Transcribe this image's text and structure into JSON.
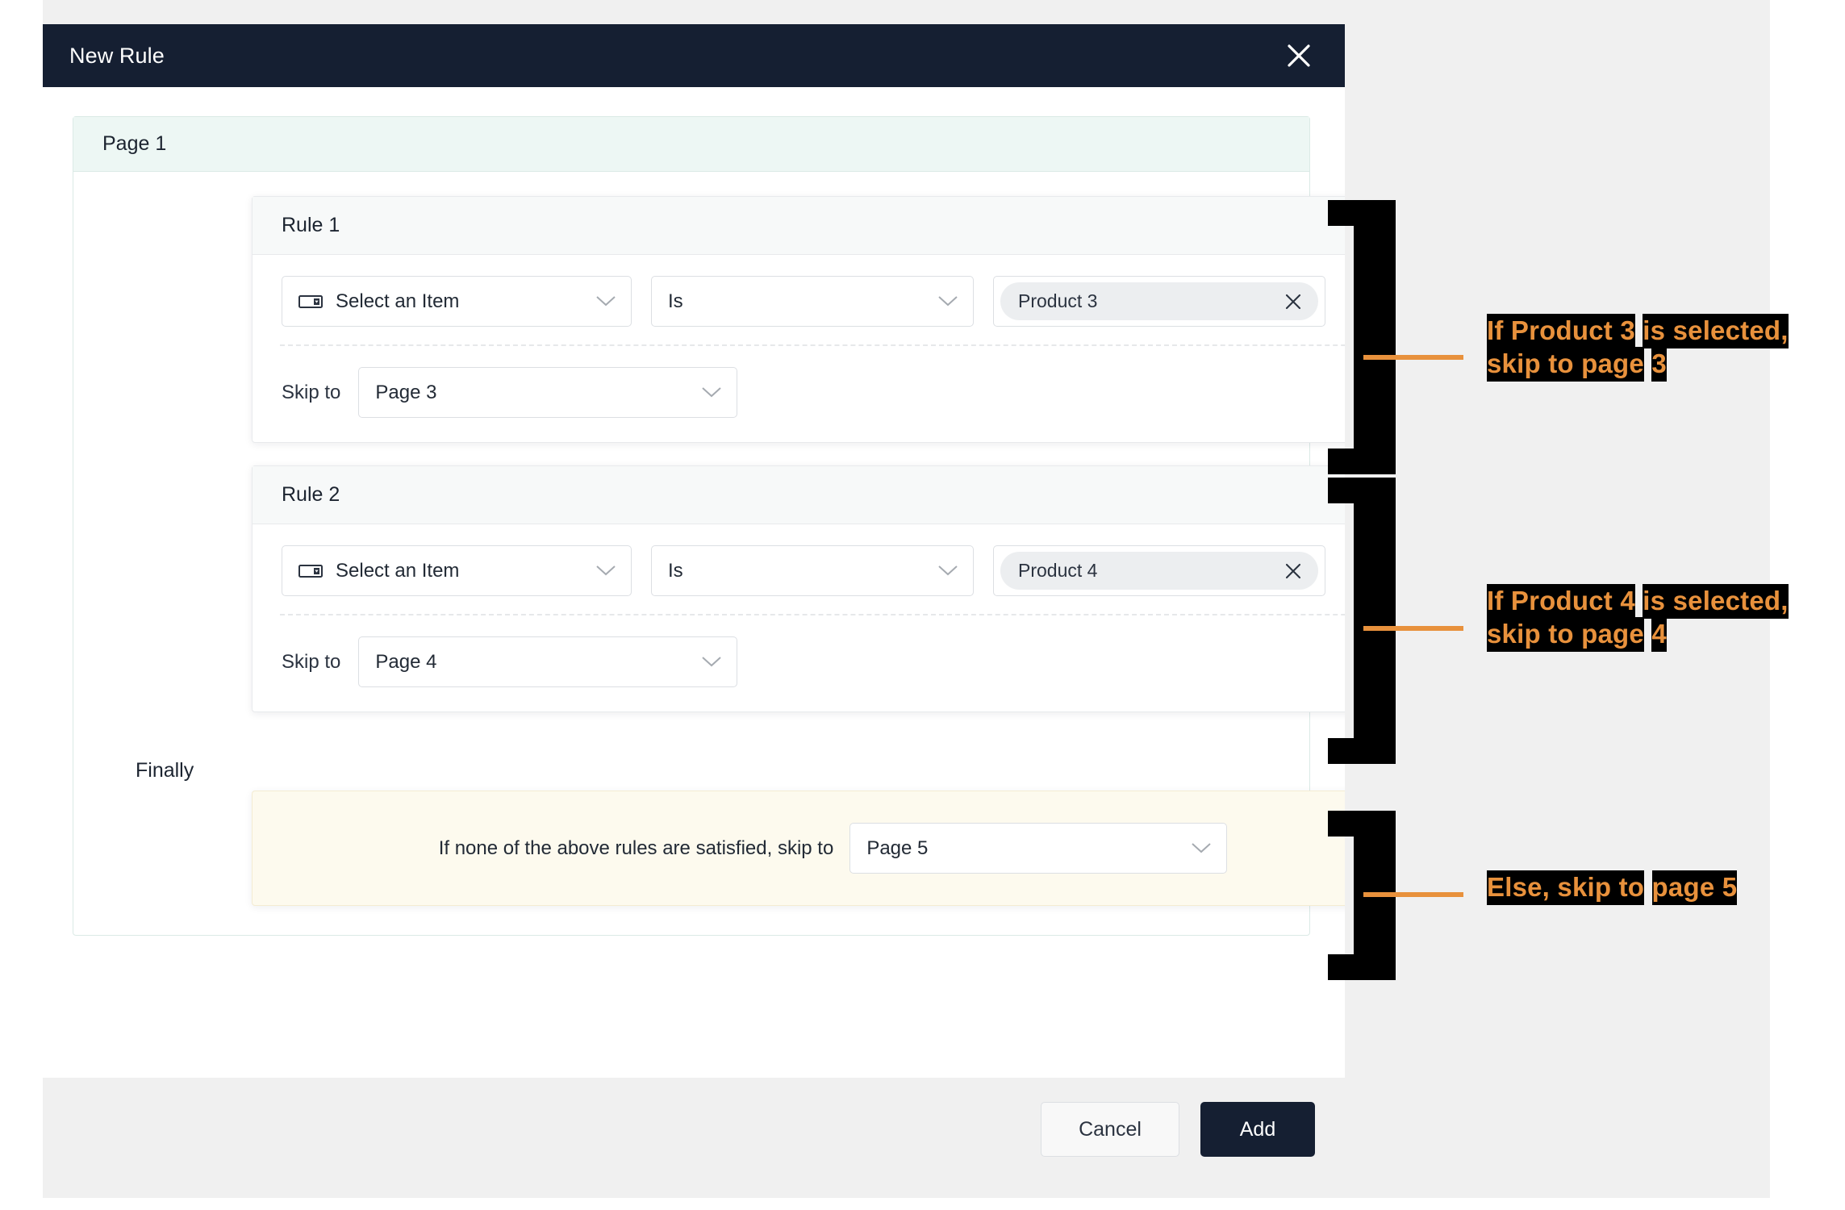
{
  "modal": {
    "title": "New Rule",
    "close_icon": "close-icon"
  },
  "page_group": {
    "title": "Page 1"
  },
  "rules": [
    {
      "title": "Rule 1",
      "item_icon": "dropdown-field-icon",
      "item_label": "Select an Item",
      "operator_label": "Is",
      "value_chip": "Product 3",
      "value_remove_icon": "close-icon",
      "skip_label": "Skip to",
      "skip_value": "Page 3"
    },
    {
      "title": "Rule 2",
      "item_icon": "dropdown-field-icon",
      "item_label": "Select an Item",
      "operator_label": "Is",
      "value_chip": "Product 4",
      "value_remove_icon": "close-icon",
      "skip_label": "Skip to",
      "skip_value": "Page 4"
    }
  ],
  "finally": {
    "label": "Finally",
    "text": "If none of the above rules are satisfied, skip to",
    "value": "Page 5"
  },
  "footer": {
    "cancel_label": "Cancel",
    "add_label": "Add"
  },
  "annotations": [
    {
      "line1": "If Product 3",
      "line1b": "is selected,",
      "line2": "skip to page",
      "line2b": "3"
    },
    {
      "line1": "If Product 4",
      "line1b": "is selected,",
      "line2": "skip to page",
      "line2b": "4"
    },
    {
      "line1": "Else, skip to",
      "line1b": "page 5",
      "line2": "",
      "line2b": ""
    }
  ],
  "colors": {
    "header_bg": "#151f32",
    "accent_orange": "#e8913c",
    "page_group_bg": "#edf7f4",
    "finally_bg": "#fdfaee",
    "backdrop": "#f0f0f0"
  }
}
